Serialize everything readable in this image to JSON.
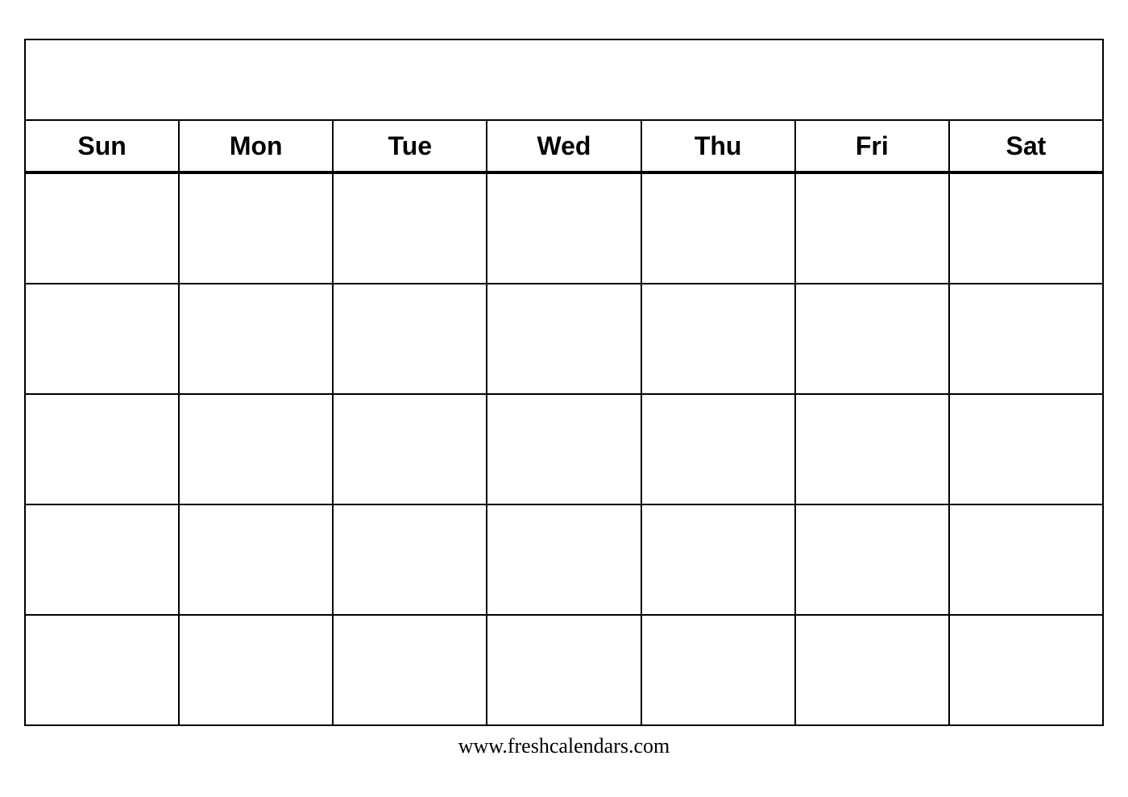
{
  "calendar": {
    "days": [
      "Sun",
      "Mon",
      "Tue",
      "Wed",
      "Thu",
      "Fri",
      "Sat"
    ],
    "num_rows": 5,
    "footer_text": "www.freshcalendars.com"
  }
}
